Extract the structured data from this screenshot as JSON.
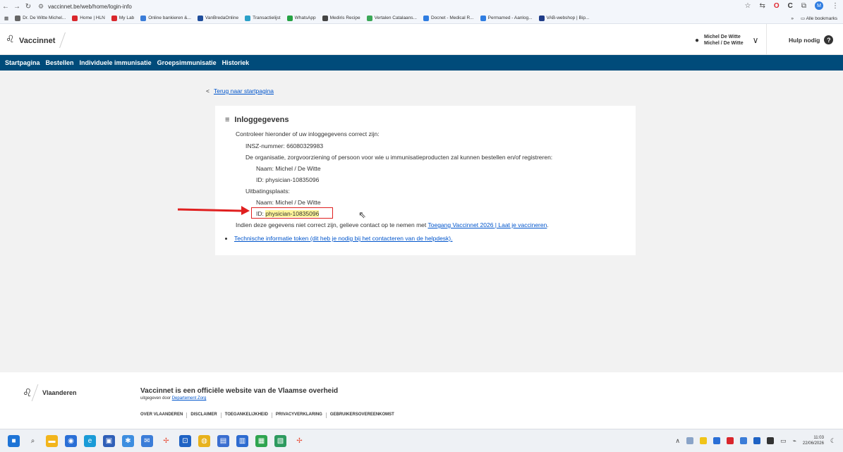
{
  "browser": {
    "url": "vaccinnet.be/web/home/login-info",
    "bookmarks": [
      {
        "label": "Dr. De Witte Michel...",
        "color": "#666666"
      },
      {
        "label": "Home | HLN",
        "color": "#d9262c"
      },
      {
        "label": "My Lab",
        "color": "#d9262c"
      },
      {
        "label": "Online bankieren &...",
        "color": "#3b7dd8"
      },
      {
        "label": "VanBredaOnline",
        "color": "#1f4e9c"
      },
      {
        "label": "Transactielijst",
        "color": "#2aa0c8"
      },
      {
        "label": "WhatsApp",
        "color": "#25a244"
      },
      {
        "label": "Mediris Recipe",
        "color": "#444444"
      },
      {
        "label": "Vertalen Catalaans...",
        "color": "#3aa757"
      },
      {
        "label": "Docnet - Medical R...",
        "color": "#2f7de1"
      },
      {
        "label": "Permamed - Aanlog...",
        "color": "#2f7de1"
      },
      {
        "label": "VAB-webshop | Bip...",
        "color": "#1f3c88"
      }
    ],
    "bookmarks_overflow": "»",
    "all_bookmarks": "Alle bookmarks",
    "profile_initial": "M"
  },
  "app": {
    "title": "Vaccinnet",
    "user_line1": "Michel De Witte",
    "user_line2": "Michel / De Witte",
    "help_label": "Hulp nodig",
    "help_icon": "?"
  },
  "nav": {
    "items": [
      "Startpagina",
      "Bestellen",
      "Individuele immunisatie",
      "Groepsimmunisatie",
      "Historiek"
    ]
  },
  "back": {
    "chevron": "<",
    "label": "Terug naar startpagina"
  },
  "card": {
    "title": "Inloggegevens",
    "intro": "Controleer hieronder of uw inloggegevens correct zijn:",
    "insz": "INSZ-nummer: 66080329983",
    "org_intro": "De organisatie, zorgvoorziening of persoon voor wie u immunisatieproducten zal kunnen bestellen en/of registreren:",
    "org_name": "Naam: Michel / De Witte",
    "org_id": "ID: physician-10835096",
    "site_label": "Uitbatingsplaats:",
    "site_name": "Naam: Michel / De Witte",
    "site_id_prefix": "ID: ",
    "site_id_value": "physician-10835096",
    "incorrect_text": "Indien deze gegevens niet correct zijn, gelieve contact op te nemen met ",
    "incorrect_link": "Toegang Vaccinnet 2026 | Laat je vaccineren",
    "incorrect_end": ".",
    "token_link": "Technische informatie token (dit heb je nodig bij het contacteren van de helpdesk)."
  },
  "footer": {
    "region": "Vlaanderen",
    "main": "Vaccinnet is een officiële website van de Vlaamse overheid",
    "sub_prefix": "uitgegeven door ",
    "sub_link": "Departement Zorg",
    "links": [
      "OVER VLAANDEREN",
      "DISCLAIMER",
      "TOEGANKELIJKHEID",
      "PRIVACYVERKLARING",
      "GEBRUIKERSOVEREENKOMST"
    ]
  },
  "taskbar": {
    "time": "11:03",
    "date": "22/06/2026"
  },
  "colors": {
    "nav_bg": "#004b7a",
    "link": "#0055cc",
    "highlight": "#fff59a",
    "annotation_red": "#e02020"
  }
}
